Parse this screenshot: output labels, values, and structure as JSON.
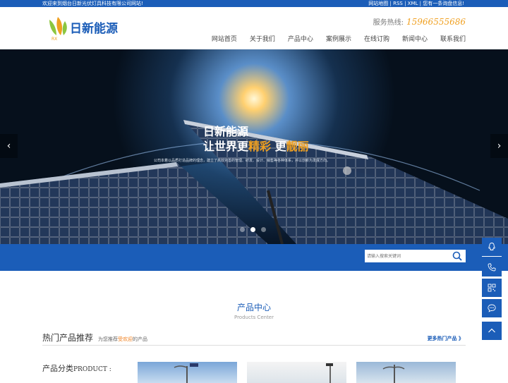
{
  "topbar": {
    "welcome": "欢迎来到烟台日新光伏灯具科技有限公司网站!",
    "links": "网站地图 | RSS | XML | 您有一条询盘信息!"
  },
  "header": {
    "logo_text": "日新能源",
    "logo_mark": "RX",
    "hotline_label": "服务热线:",
    "hotline_number": "15966555686"
  },
  "nav": {
    "items": [
      "网站首页",
      "关于我们",
      "产品中心",
      "案例展示",
      "在线订购",
      "新闻中心",
      "联系我们"
    ]
  },
  "banner": {
    "title": "日新能源",
    "sub_prefix": "让世界更",
    "sub_hl1": "精彩",
    "sub_mid": " 更",
    "sub_hl2": "靓丽",
    "desc": "公司本着以品质打造品牌的理念，建立了高效完善的管理、研发、设计、销售等各种体系，并以创新为发展方向。",
    "prev": "‹",
    "next": "›",
    "slide_count": 3,
    "active_slide": 2
  },
  "search": {
    "placeholder": "请输入搜索关键词"
  },
  "products": {
    "title_cn": "产品中心",
    "title_en": "Products  Center",
    "hot_title": "热门产品推荐",
    "hot_desc_prefix": "为您推荐",
    "hot_desc_hl": "受欢迎",
    "hot_desc_suffix": "的产品",
    "more": "更多热门产品 》",
    "cat_cn": "产品分类",
    "cat_en": "PRODUCT :"
  },
  "colors": {
    "brand_blue": "#1b5db8",
    "accent_orange": "#f0a020"
  },
  "sidebar_icons": [
    "qq-icon",
    "phone-icon",
    "qrcode-icon",
    "chat-icon",
    "back-to-top-icon"
  ]
}
